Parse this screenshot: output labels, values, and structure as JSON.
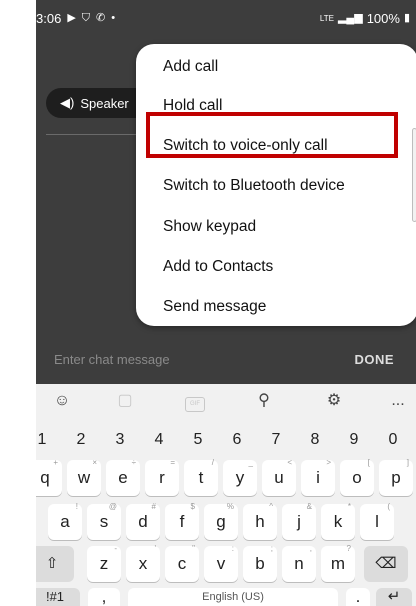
{
  "status_bar": {
    "time": "3:06",
    "battery_text": "100%",
    "network_label": "LTE",
    "left_icons": [
      "play-icon",
      "shield-icon",
      "phone-icon",
      "dot-icon"
    ],
    "right_icons": [
      "signal-icon",
      "battery-icon"
    ]
  },
  "call_screen": {
    "speaker_label": "Speaker"
  },
  "menu": {
    "items": [
      {
        "label": "Add call"
      },
      {
        "label": "Hold call"
      },
      {
        "label": "Switch to voice-only call",
        "highlighted": true
      },
      {
        "label": "Switch to Bluetooth device"
      },
      {
        "label": "Show keypad"
      },
      {
        "label": "Add to Contacts"
      },
      {
        "label": "Send message"
      }
    ]
  },
  "chat": {
    "placeholder": "Enter chat message",
    "done_label": "DONE"
  },
  "keyboard": {
    "toolbar_icons": [
      "emoji-icon",
      "sticker-icon",
      "gif-icon",
      "microphone-icon",
      "settings-icon",
      "more-icon"
    ],
    "gif_label": "GIF",
    "more_label": "...",
    "numbers": [
      "1",
      "2",
      "3",
      "4",
      "5",
      "6",
      "7",
      "8",
      "9",
      "0"
    ],
    "row1": [
      {
        "key": "q",
        "hint": "+"
      },
      {
        "key": "w",
        "hint": "×"
      },
      {
        "key": "e",
        "hint": "÷"
      },
      {
        "key": "r",
        "hint": "="
      },
      {
        "key": "t",
        "hint": "/"
      },
      {
        "key": "y",
        "hint": "_"
      },
      {
        "key": "u",
        "hint": "<"
      },
      {
        "key": "i",
        "hint": ">"
      },
      {
        "key": "o",
        "hint": "["
      },
      {
        "key": "p",
        "hint": "]"
      }
    ],
    "row2": [
      {
        "key": "a",
        "hint": "!"
      },
      {
        "key": "s",
        "hint": "@"
      },
      {
        "key": "d",
        "hint": "#"
      },
      {
        "key": "f",
        "hint": "$"
      },
      {
        "key": "g",
        "hint": "%"
      },
      {
        "key": "h",
        "hint": "^"
      },
      {
        "key": "j",
        "hint": "&"
      },
      {
        "key": "k",
        "hint": "*"
      },
      {
        "key": "l",
        "hint": "("
      }
    ],
    "row3": [
      {
        "key": "z",
        "hint": "-"
      },
      {
        "key": "x",
        "hint": "'"
      },
      {
        "key": "c",
        "hint": "\""
      },
      {
        "key": "v",
        "hint": ":"
      },
      {
        "key": "b",
        "hint": ";"
      },
      {
        "key": "n",
        "hint": ","
      },
      {
        "key": "m",
        "hint": "?"
      }
    ],
    "shift_glyph": "⇧",
    "backspace_glyph": "⌫",
    "symbols_label": "!#1",
    "comma_label": ",",
    "space_label": "English (US)",
    "period_label": ".",
    "enter_glyph": "↵"
  },
  "colors": {
    "highlight_border": "#c00000",
    "call_background": "#3d3d3d",
    "keyboard_background": "#f1f1f1"
  }
}
